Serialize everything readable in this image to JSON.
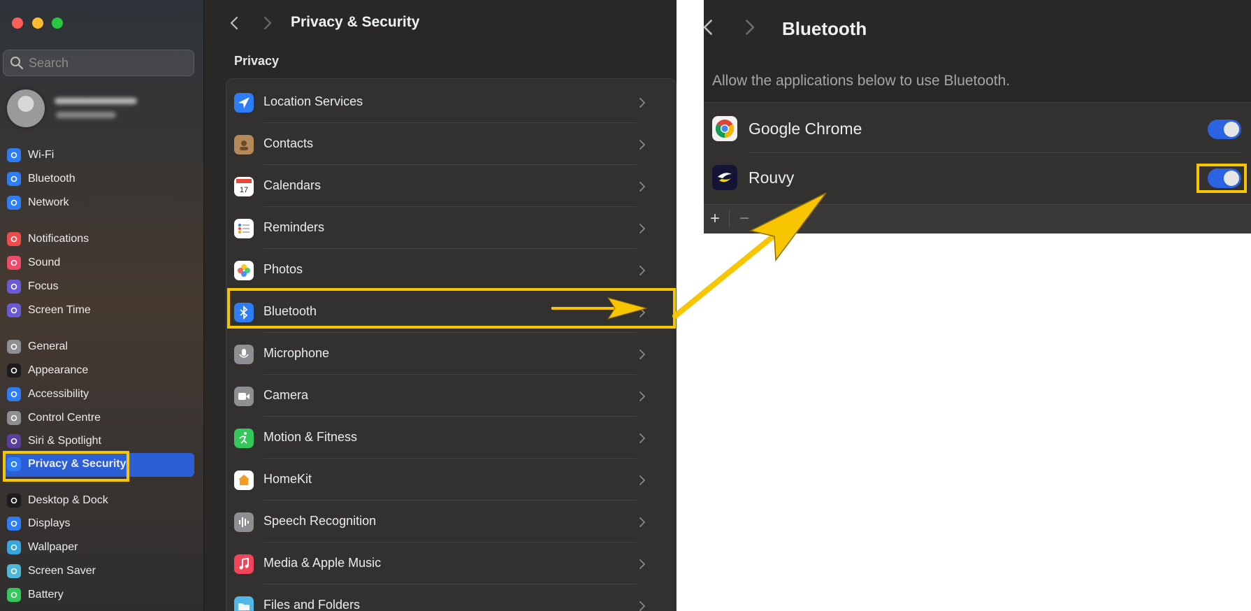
{
  "window": {
    "traffic_lights": [
      "close",
      "minimize",
      "zoom"
    ]
  },
  "sidebar": {
    "search_placeholder": "Search",
    "items": [
      {
        "label": "Wi-Fi",
        "icon": "wifi-icon",
        "color": "#2f7df6"
      },
      {
        "label": "Bluetooth",
        "icon": "bluetooth-icon",
        "color": "#2f7df6"
      },
      {
        "label": "Network",
        "icon": "globe-icon",
        "color": "#2f7df6"
      },
      {
        "label": "Notifications",
        "icon": "bell-icon",
        "color": "#f04a4a"
      },
      {
        "label": "Sound",
        "icon": "speaker-icon",
        "color": "#f04a6a"
      },
      {
        "label": "Focus",
        "icon": "moon-icon",
        "color": "#6a5ad6"
      },
      {
        "label": "Screen Time",
        "icon": "hourglass-icon",
        "color": "#6a5ad6"
      },
      {
        "label": "General",
        "icon": "gear-icon",
        "color": "#8e8e93"
      },
      {
        "label": "Appearance",
        "icon": "appearance-icon",
        "color": "#1c1c1e"
      },
      {
        "label": "Accessibility",
        "icon": "accessibility-icon",
        "color": "#2f7df6"
      },
      {
        "label": "Control Centre",
        "icon": "control-centre-icon",
        "color": "#8e8e93"
      },
      {
        "label": "Siri & Spotlight",
        "icon": "siri-icon",
        "color": "#5a3fa0"
      },
      {
        "label": "Privacy & Security",
        "icon": "hand-icon",
        "color": "#2f7df6",
        "selected": true
      },
      {
        "label": "Desktop & Dock",
        "icon": "dock-icon",
        "color": "#1c1c1e"
      },
      {
        "label": "Displays",
        "icon": "sun-icon",
        "color": "#2f7df6"
      },
      {
        "label": "Wallpaper",
        "icon": "wallpaper-icon",
        "color": "#35a7e0"
      },
      {
        "label": "Screen Saver",
        "icon": "screen-saver-icon",
        "color": "#4fb8d9"
      },
      {
        "label": "Battery",
        "icon": "battery-icon",
        "color": "#34c759"
      }
    ]
  },
  "main": {
    "title": "Privacy & Security",
    "section": "Privacy",
    "rows": [
      {
        "label": "Location Services",
        "icon": "location-arrow-icon",
        "color": "#2f7df6"
      },
      {
        "label": "Contacts",
        "icon": "contacts-icon",
        "color": "#b48a5a"
      },
      {
        "label": "Calendars",
        "icon": "calendar-icon",
        "color": "#ffffff",
        "day": "17",
        "month": "JUL"
      },
      {
        "label": "Reminders",
        "icon": "reminders-icon",
        "color": "#ffffff"
      },
      {
        "label": "Photos",
        "icon": "photos-icon",
        "color": "#ffffff"
      },
      {
        "label": "Bluetooth",
        "icon": "bluetooth-icon",
        "color": "#2f7df6",
        "highlighted": true
      },
      {
        "label": "Microphone",
        "icon": "microphone-icon",
        "color": "#8e8e93"
      },
      {
        "label": "Camera",
        "icon": "camera-icon",
        "color": "#8e8e93"
      },
      {
        "label": "Motion & Fitness",
        "icon": "running-figure-icon",
        "color": "#34c759"
      },
      {
        "label": "HomeKit",
        "icon": "home-icon",
        "color": "#ffffff"
      },
      {
        "label": "Speech Recognition",
        "icon": "waveform-icon",
        "color": "#8e8e93"
      },
      {
        "label": "Media & Apple Music",
        "icon": "music-note-icon",
        "color": "#f0455a"
      },
      {
        "label": "Files and Folders",
        "icon": "folder-icon",
        "color": "#4fb8e8"
      }
    ]
  },
  "bluetooth_panel": {
    "title": "Bluetooth",
    "description": "Allow the applications below to use Bluetooth.",
    "apps": [
      {
        "name": "Google Chrome",
        "icon": "chrome-icon",
        "enabled": true
      },
      {
        "name": "Rouvy",
        "icon": "rouvy-icon",
        "enabled": true,
        "highlighted": true
      }
    ],
    "add_label": "+",
    "remove_label": "−"
  },
  "annotation_color": "#f7c600",
  "accent_color": "#2c63e0"
}
